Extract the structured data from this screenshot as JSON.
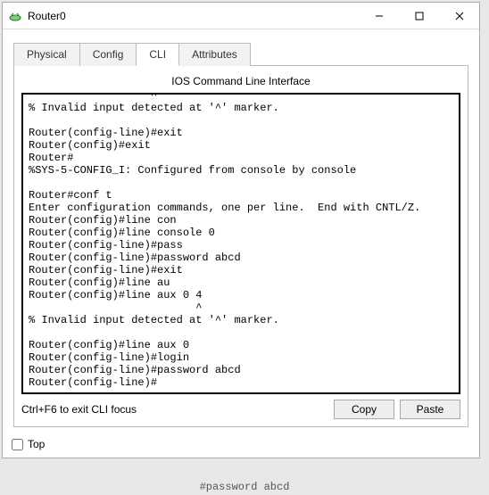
{
  "window": {
    "title": "Router0"
  },
  "tabs": {
    "physical": "Physical",
    "config": "Config",
    "cli": "CLI",
    "attributes": "Attributes"
  },
  "cli": {
    "subtitle": "IOS Command Line Interface",
    "terminal_text": "Router(config-line)#clear\n                   ^\n% Invalid input detected at '^' marker.\n\nRouter(config-line)#exit\nRouter(config)#exit\nRouter#\n%SYS-5-CONFIG_I: Configured from console by console\n\nRouter#conf t\nEnter configuration commands, one per line.  End with CNTL/Z.\nRouter(config)#line con\nRouter(config)#line console 0\nRouter(config-line)#pass\nRouter(config-line)#password abcd\nRouter(config-line)#exit\nRouter(config)#line au\nRouter(config)#line aux 0 4\n                          ^\n% Invalid input detected at '^' marker.\n\nRouter(config)#line aux 0\nRouter(config-line)#login\nRouter(config-line)#password abcd\nRouter(config-line)#",
    "hint": "Ctrl+F6 to exit CLI focus",
    "copy": "Copy",
    "paste": "Paste"
  },
  "footer": {
    "top": "Top"
  },
  "stray": "#password abcd"
}
